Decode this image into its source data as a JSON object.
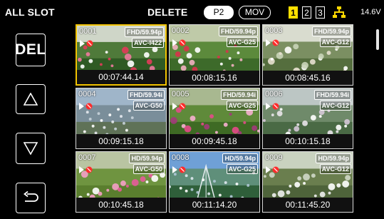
{
  "header": {
    "slot_label": "ALL SLOT",
    "mode_title": "DELETE",
    "format_tabs": [
      {
        "label": "P2",
        "active": true
      },
      {
        "label": "MOV",
        "active": false
      }
    ],
    "slots": [
      {
        "label": "1",
        "active": true
      },
      {
        "label": "2",
        "active": false
      },
      {
        "label": "3",
        "active": false
      }
    ],
    "network_icon": "network-icon",
    "voltage": "14.6V"
  },
  "sidebar": {
    "del_label": "DEL",
    "up_icon": "up-triangle-icon",
    "down_icon": "down-triangle-icon",
    "return_icon": "return-icon"
  },
  "colors": {
    "selection": "#f2c300",
    "slot_active": "#ffe000",
    "status_icon": "#ff2c2c"
  },
  "thumbnails": [
    {
      "clip": "0001",
      "format": "FHD/59.94p",
      "codec": "AVC-I422",
      "timecode": "00:07:44.14",
      "selected": true
    },
    {
      "clip": "0002",
      "format": "FHD/59.94p",
      "codec": "AVC-G25",
      "timecode": "00:08:15.16",
      "selected": false
    },
    {
      "clip": "0003",
      "format": "FHD/59.94p",
      "codec": "AVC-G12",
      "timecode": "00:08:45.16",
      "selected": false
    },
    {
      "clip": "0004",
      "format": "FHD/59.94i",
      "codec": "AVC-G50",
      "timecode": "00:09:15.18",
      "selected": false
    },
    {
      "clip": "0005",
      "format": "FHD/59.94i",
      "codec": "AVC-G25",
      "timecode": "00:09:45.18",
      "selected": false
    },
    {
      "clip": "0006",
      "format": "FHD/59.94i",
      "codec": "AVC-G12",
      "timecode": "00:10:15.18",
      "selected": false
    },
    {
      "clip": "0007",
      "format": "HD/59.94p",
      "codec": "AVC-G50",
      "timecode": "00:10:45.18",
      "selected": false
    },
    {
      "clip": "0008",
      "format": "HD/59.94p",
      "codec": "AVC-G25",
      "timecode": "00:11:14.20",
      "selected": false
    },
    {
      "clip": "0009",
      "format": "HD/59.94p",
      "codec": "AVC-G12",
      "timecode": "00:11:45.20",
      "selected": false
    }
  ]
}
